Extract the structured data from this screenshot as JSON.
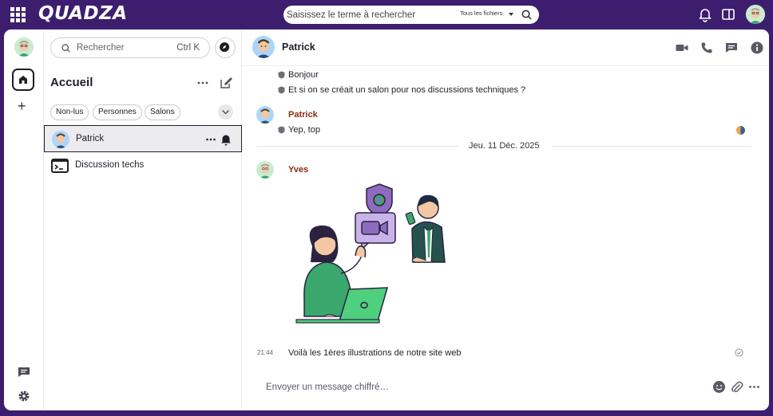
{
  "topbar": {
    "logo": "QUADZA",
    "search": {
      "placeholder": "Saisissez le terme à rechercher",
      "scope": "Tous les fichiers"
    }
  },
  "sidebar": {
    "search_placeholder": "Rechercher",
    "search_shortcut": "Ctrl K",
    "title": "Accueil",
    "filters": [
      "Non-lus",
      "Personnes",
      "Salons"
    ],
    "rooms": [
      {
        "name": "Patrick",
        "active": true
      },
      {
        "name": "Discussion techs",
        "active": false
      }
    ]
  },
  "chat": {
    "room_name": "Patrick",
    "messages_before": [
      {
        "text": "Bonjour"
      },
      {
        "text": "Et si on se créait un salon pour nos discussions techniques ?"
      }
    ],
    "patrick_block": {
      "sender": "Patrick",
      "text": "Yep, top"
    },
    "date_separator": "Jeu. 11 Déc. 2025",
    "yves_block": {
      "sender": "Yves",
      "timestamp": "21:44",
      "text": "Voilà les 1ères illustrations de notre site web"
    },
    "composer_placeholder": "Envoyer un message chiffré…"
  },
  "colors": {
    "brand_purple": "#3d1e6e",
    "sender_name": "#8a2a14",
    "illustration_green": "#3aa76d",
    "illustration_purple": "#8e6bbf"
  },
  "icons": {
    "topbar": [
      "apps-grid-icon",
      "bell-icon",
      "side-panel-icon"
    ],
    "rail": [
      "home-icon",
      "plus-icon",
      "threads-icon",
      "settings-icon"
    ],
    "chat_header": [
      "video-call-icon",
      "voice-call-icon",
      "threads-icon",
      "info-icon"
    ],
    "composer": [
      "emoji-icon",
      "attachment-icon",
      "more-options-icon"
    ]
  }
}
